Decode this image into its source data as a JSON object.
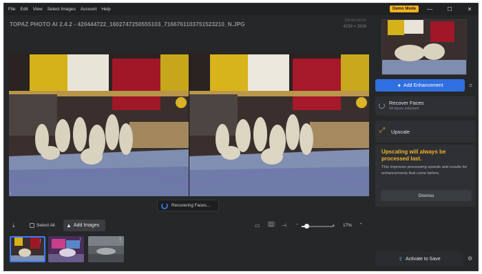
{
  "menu": [
    "File",
    "Edit",
    "View",
    "Select Images",
    "Account",
    "Help"
  ],
  "demo_badge": "Demo Mode",
  "window_controls": {
    "minimize": "—",
    "maximize": "☐",
    "close": "✕"
  },
  "title": "TOPAZ PHOTO AI 2.4.2 - 420444722_1602747250555103_7166761103751523210_N.JPG",
  "dimensions": {
    "label": "Dimensions",
    "value": "4239 × 2826"
  },
  "status": {
    "text": "Recovering Faces..."
  },
  "toolbar": {
    "select_all": "Select All",
    "add_images": "Add Images",
    "zoom_percent": "17%",
    "zoom_level": 0.17
  },
  "thumbnails": [
    {
      "name": "thumb-1",
      "selected": true
    },
    {
      "name": "thumb-2",
      "selected": false
    },
    {
      "name": "thumb-3",
      "selected": false
    }
  ],
  "sidebar": {
    "add_enhancement": "Add Enhancement",
    "recover_faces": {
      "title": "Recover Faces",
      "subtitle": "34 faces selected"
    },
    "upscale": {
      "title": "Upscale"
    },
    "notice": {
      "title": "Upscaling will always be processed last.",
      "body": "This improves processing speeds and results for enhancements that come before.",
      "dismiss": "Dismiss"
    },
    "activate": "Activate to Save"
  },
  "colors": {
    "accent": "#2f6fe0",
    "badge": "#f4b21e",
    "warning": "#f2b42a",
    "panel": "#252729"
  },
  "icons": {
    "import": "import-icon",
    "add_image": "add-image-icon",
    "single_view": "single-view-icon",
    "side_by_side": "side-by-side-icon",
    "split": "split-view-icon",
    "crop": "crop-icon",
    "upscale": "upscale-icon",
    "save": "save-icon",
    "export": "export-settings-icon"
  }
}
